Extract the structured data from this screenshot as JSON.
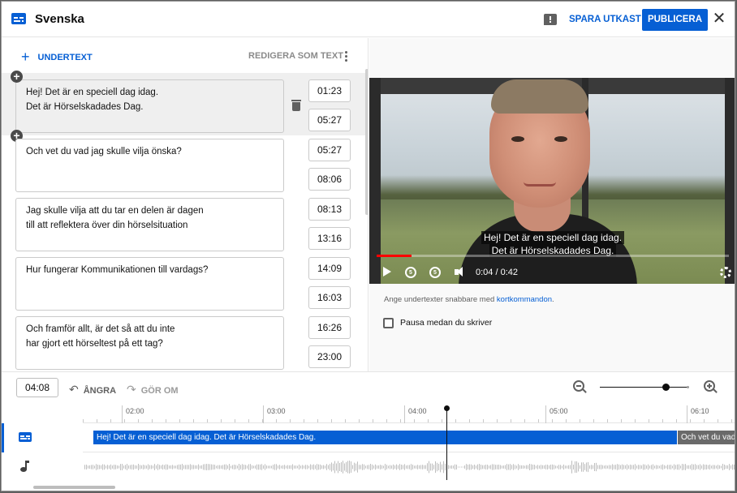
{
  "header": {
    "title": "Svenska",
    "save_draft": "SPARA UTKAST",
    "publish": "PUBLICERA",
    "close_glyph": "✕",
    "icons": [
      "subtitles-icon",
      "feedback-icon",
      "close-icon"
    ]
  },
  "editor": {
    "add_subtitle": "UNDERTEXT",
    "edit_as_text": "REDIGERA SOM TEXT",
    "cues": [
      {
        "text": "Hej! Det är en speciell dag idag.\nDet är Hörselskadades Dag.",
        "start": "01:23",
        "end": "05:27",
        "active": true
      },
      {
        "text": "Och vet du vad jag skulle vilja önska?",
        "start": "05:27",
        "end": "08:06",
        "active": false
      },
      {
        "text": "Jag skulle vilja att du tar en delen är dagen\ntill att reflektera över din hörselsituation",
        "start": "08:13",
        "end": "13:16",
        "active": false
      },
      {
        "text": "Hur fungerar Kommunikationen till vardags?",
        "start": "14:09",
        "end": "16:03",
        "active": false
      },
      {
        "text": "Och framför allt, är det så att du inte\nhar gjort ett hörseltest på ett tag?",
        "start": "16:26",
        "end": "23:00",
        "active": false
      }
    ]
  },
  "video": {
    "caption_line1": "Hej! Det är en speciell dag idag.",
    "caption_line2": "Det är Hörselskadades Dag.",
    "time": "0:04 / 0:42",
    "progress": 0.1,
    "tip_prefix": "Ange undertexter snabbare med ",
    "tip_link": "kortkommandon",
    "tip_suffix": ".",
    "pause_label": "Pausa medan du skriver",
    "pause_checked": false
  },
  "timeline": {
    "current_time": "04:08",
    "undo": "ÅNGRA",
    "redo": "GÖR OM",
    "ticks": [
      "02:00",
      "03:00",
      "04:00",
      "05:00",
      "06:10"
    ],
    "segment_1": "Hej! Det är en speciell dag idag. Det är Hörselskadades Dag.",
    "segment_2": "Och vet du vad ja",
    "zoom_level": 0.75
  },
  "colors": {
    "accent": "#065fd4",
    "progress": "#ff0000",
    "muted": "#606060"
  }
}
